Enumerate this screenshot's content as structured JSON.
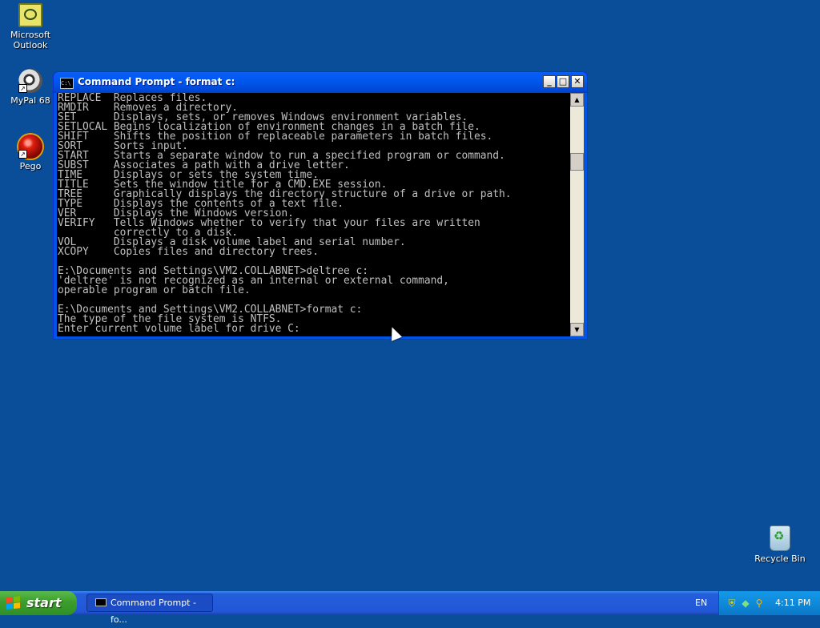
{
  "desktop": {
    "icons": [
      {
        "label": "Microsoft Outlook",
        "icon": "outlook-icon"
      },
      {
        "label": "MyPal 68",
        "icon": "mypal-icon"
      },
      {
        "label": "Pego",
        "icon": "pego-icon"
      },
      {
        "label": "Recycle Bin",
        "icon": "recycle-bin-icon"
      }
    ]
  },
  "window": {
    "title": "Command Prompt - format c:",
    "minimize": "_",
    "maximize": "□",
    "close": "✕",
    "console_lines": [
      "REPLACE  Replaces files.",
      "RMDIR    Removes a directory.",
      "SET      Displays, sets, or removes Windows environment variables.",
      "SETLOCAL Begins localization of environment changes in a batch file.",
      "SHIFT    Shifts the position of replaceable parameters in batch files.",
      "SORT     Sorts input.",
      "START    Starts a separate window to run a specified program or command.",
      "SUBST    Associates a path with a drive letter.",
      "TIME     Displays or sets the system time.",
      "TITLE    Sets the window title for a CMD.EXE session.",
      "TREE     Graphically displays the directory structure of a drive or path.",
      "TYPE     Displays the contents of a text file.",
      "VER      Displays the Windows version.",
      "VERIFY   Tells Windows whether to verify that your files are written",
      "         correctly to a disk.",
      "VOL      Displays a disk volume label and serial number.",
      "XCOPY    Copies files and directory trees.",
      "",
      "E:\\Documents and Settings\\VM2.COLLABNET>deltree c:",
      "'deltree' is not recognized as an internal or external command,",
      "operable program or batch file.",
      "",
      "E:\\Documents and Settings\\VM2.COLLABNET>format c:",
      "The type of the file system is NTFS.",
      "Enter current volume label for drive C:"
    ]
  },
  "taskbar": {
    "start_label": "start",
    "task_button_label": "Command Prompt - fo...",
    "language": "EN",
    "clock": "4:11 PM"
  },
  "colors": {
    "desktop": "#0a4d98",
    "console_bg": "#000000",
    "console_fg": "#c0c0c0",
    "titlebar": "#0058ee"
  }
}
